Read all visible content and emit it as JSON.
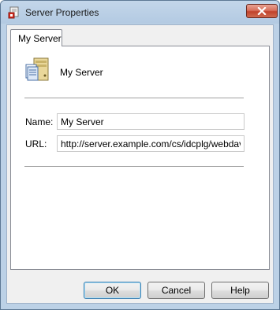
{
  "window": {
    "title": "Server Properties",
    "close_icon": "close-icon",
    "app_icon": "server-properties-app-icon"
  },
  "tabs": [
    {
      "label": "My Server",
      "selected": true
    }
  ],
  "header": {
    "icon": "server-icon",
    "server_name": "My Server"
  },
  "form": {
    "name_label": "Name:",
    "name_value": "My Server",
    "url_label": "URL:",
    "url_value": "http://server.example.com/cs/idcplg/webdav"
  },
  "buttons": {
    "ok_label": "OK",
    "cancel_label": "Cancel",
    "help_label": "Help"
  },
  "colors": {
    "titlebar": "#bcd1e6",
    "close_button": "#c1422b",
    "default_button_border": "#3c7fb1"
  }
}
